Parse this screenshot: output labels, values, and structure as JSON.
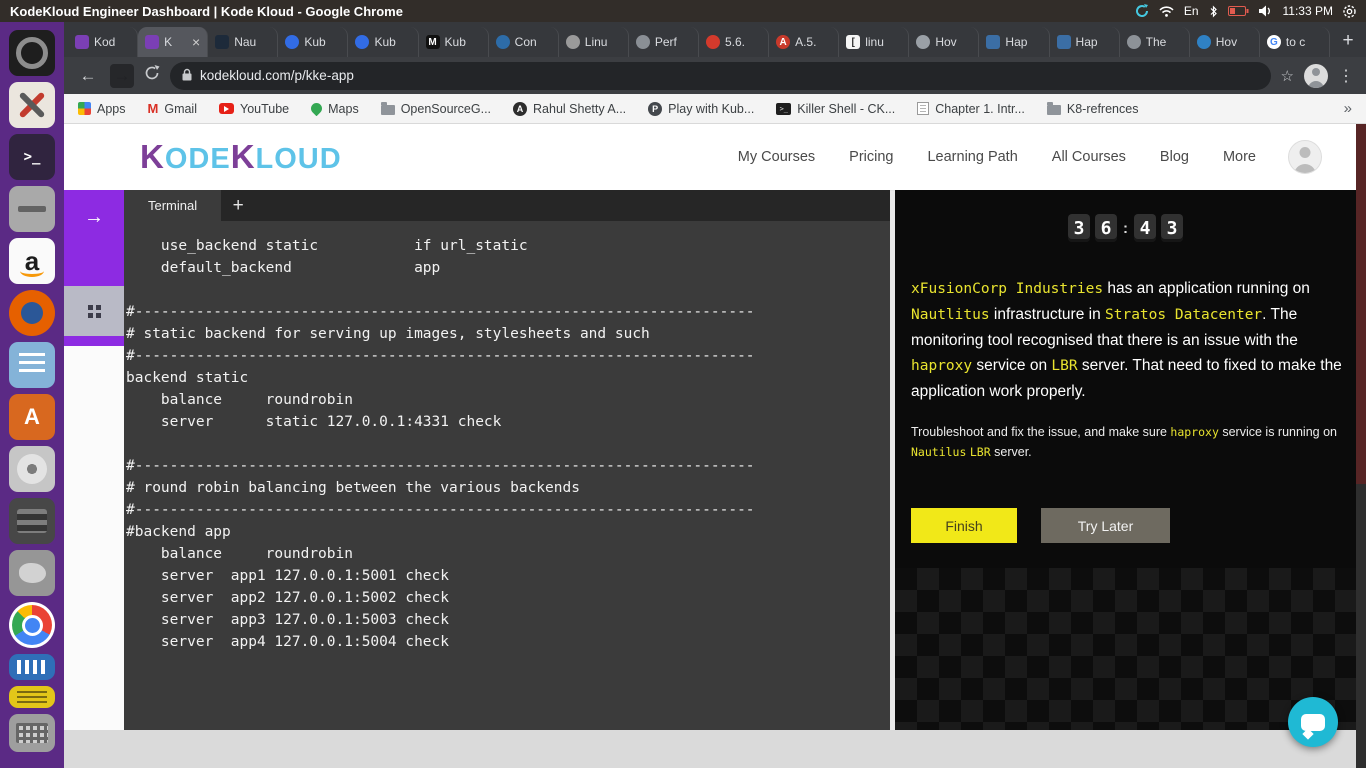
{
  "system_bar": {
    "title": "KodeKloud Engineer Dashboard | Kode Kloud - Google Chrome",
    "language": "En",
    "time": "11:33 PM"
  },
  "launcher": {
    "items": [
      {
        "name": "app-icon-settings",
        "kind": "ring"
      },
      {
        "name": "app-icon-tools",
        "kind": "tools"
      },
      {
        "name": "app-icon-terminal",
        "kind": "terminal",
        "glyph": ">_"
      },
      {
        "name": "app-icon-archive",
        "kind": "slot"
      },
      {
        "name": "app-icon-amazon",
        "kind": "amazon",
        "glyph": "a"
      },
      {
        "name": "app-icon-firefox",
        "kind": "firefox"
      },
      {
        "name": "app-icon-text-editor",
        "kind": "editor"
      },
      {
        "name": "app-icon-software-center",
        "kind": "software",
        "glyph": "A"
      },
      {
        "name": "app-icon-disks",
        "kind": "disk"
      },
      {
        "name": "app-icon-drives",
        "kind": "stack"
      },
      {
        "name": "app-icon-image-tool",
        "kind": "blob"
      },
      {
        "name": "app-icon-chrome",
        "kind": "chrome"
      },
      {
        "name": "app-icon-monitor",
        "kind": "monitor"
      },
      {
        "name": "app-icon-notes",
        "kind": "notes"
      },
      {
        "name": "app-icon-keyboard",
        "kind": "keyboard"
      }
    ]
  },
  "browser": {
    "tabs": [
      {
        "label": "Kod",
        "icon": {
          "shape": "square",
          "color": "#7b3fb5"
        }
      },
      {
        "label": "K",
        "active": true,
        "icon": {
          "shape": "square",
          "color": "#7b3fb5"
        }
      },
      {
        "label": "Nau",
        "icon": {
          "shape": "square",
          "color": "#1d2a3a"
        }
      },
      {
        "label": "Kub",
        "icon": {
          "shape": "circle",
          "color": "#326ce5"
        }
      },
      {
        "label": "Kub",
        "icon": {
          "shape": "circle",
          "color": "#326ce5"
        }
      },
      {
        "label": "Kub",
        "icon": {
          "shape": "square",
          "color": "#111111",
          "letter": "M",
          "letter_color": "#ffffff"
        }
      },
      {
        "label": "Con",
        "icon": {
          "shape": "circle",
          "color": "#2d6ca8"
        }
      },
      {
        "label": "Linu",
        "icon": {
          "shape": "circle",
          "color": "#9a9a9a"
        }
      },
      {
        "label": "Perf",
        "icon": {
          "shape": "circle",
          "color": "#8a8f95"
        }
      },
      {
        "label": "5.6.",
        "icon": {
          "shape": "circle",
          "color": "#d33a2c"
        }
      },
      {
        "label": "A.5.",
        "icon": {
          "shape": "circle",
          "color": "#c8392b",
          "letter": "A",
          "letter_color": "#ffffff"
        }
      },
      {
        "label": "linu",
        "icon": {
          "shape": "square",
          "color": "#f5f5f5",
          "letter": "[",
          "letter_color": "#333333"
        }
      },
      {
        "label": "Hov",
        "icon": {
          "shape": "circle",
          "color": "#9aa0a6"
        }
      },
      {
        "label": "Hap",
        "icon": {
          "shape": "square",
          "color": "#3b6ea5"
        }
      },
      {
        "label": "Hap",
        "icon": {
          "shape": "square",
          "color": "#3b6ea5"
        }
      },
      {
        "label": "The",
        "icon": {
          "shape": "circle",
          "color": "#8d9298"
        }
      },
      {
        "label": "Hov",
        "icon": {
          "shape": "circle",
          "color": "#2f81c4"
        }
      },
      {
        "label": "to c",
        "icon": {
          "shape": "circle",
          "color": "#ffffff",
          "letter": "G",
          "letter_color": "#4285f4"
        }
      }
    ],
    "tab_close": "×",
    "new_tab_label": "+",
    "toolbar": {
      "back": "←",
      "forward": "→",
      "menu": "⋮",
      "star": "☆"
    },
    "url": "kodekloud.com/p/kke-app",
    "bookmarks": [
      {
        "label": "Apps",
        "type": "grid"
      },
      {
        "label": "Gmail",
        "type": "letter",
        "letter": "M",
        "color": "#d93025"
      },
      {
        "label": "YouTube",
        "type": "play"
      },
      {
        "label": "Maps",
        "type": "pin"
      },
      {
        "label": "OpenSourceG...",
        "type": "folder"
      },
      {
        "label": "Rahul Shetty A...",
        "type": "letter-circle",
        "letter": "A",
        "color": "#2d2d2d"
      },
      {
        "label": "Play with Kub...",
        "type": "letter-circle",
        "letter": "P",
        "color": "#44484d"
      },
      {
        "label": "Killer Shell - CK...",
        "type": "terminal",
        "letter": ">_"
      },
      {
        "label": "Chapter 1. Intr...",
        "type": "book"
      },
      {
        "label": "K8-refrences",
        "type": "folder"
      }
    ],
    "bookmarks_overflow": "»"
  },
  "site_header": {
    "logo": {
      "k1": "K",
      "mid": "ODE",
      "k2": "K",
      "tail": "LOUD"
    },
    "nav": [
      "My Courses",
      "Pricing",
      "Learning Path",
      "All Courses",
      "Blog",
      "More"
    ]
  },
  "quiz_sidebar": {
    "expand_arrow": "→"
  },
  "terminal": {
    "tab_label": "Terminal",
    "add_tab_label": "+",
    "lines": [
      "    use_backend static           if url_static",
      "    default_backend              app",
      "",
      "#-----------------------------------------------------------------------",
      "# static backend for serving up images, stylesheets and such",
      "#-----------------------------------------------------------------------",
      "backend static",
      "    balance     roundrobin",
      "    server      static 127.0.0.1:4331 check",
      "",
      "#-----------------------------------------------------------------------",
      "# round robin balancing between the various backends",
      "#-----------------------------------------------------------------------",
      "#backend app",
      "    balance     roundrobin",
      "    server  app1 127.0.0.1:5001 check",
      "    server  app2 127.0.0.1:5002 check",
      "    server  app3 127.0.0.1:5003 check",
      "    server  app4 127.0.0.1:5004 check"
    ]
  },
  "task_panel": {
    "timer": {
      "digits": [
        "3",
        "6",
        "4",
        "3"
      ],
      "separator": ":"
    },
    "description": [
      {
        "t": "xFusionCorp Industries",
        "c": 1
      },
      {
        "t": " has an application running on ",
        "c": 0
      },
      {
        "t": "Nautlitus",
        "c": 1
      },
      {
        "t": " infrastructure in ",
        "c": 0
      },
      {
        "t": "Stratos Datacenter",
        "c": 1
      },
      {
        "t": ". The monitoring tool recognised that there is an issue with the ",
        "c": 0
      },
      {
        "t": "haproxy",
        "c": 1
      },
      {
        "t": " service on ",
        "c": 0
      },
      {
        "t": "LBR",
        "c": 1
      },
      {
        "t": " server. That need to fixed to make the application work properly.",
        "c": 0
      }
    ],
    "note": [
      {
        "t": "Troubleshoot and fix the issue, and make sure ",
        "c": 0
      },
      {
        "t": "haproxy",
        "c": 1
      },
      {
        "t": " service is running on ",
        "c": 0
      },
      {
        "t": "Nautilus",
        "c": 1
      },
      {
        "t": " ",
        "c": 0
      },
      {
        "t": "LBR",
        "c": 1
      },
      {
        "t": " server.",
        "c": 0
      }
    ],
    "buttons": {
      "finish": "Finish",
      "try_later": "Try Later"
    }
  }
}
